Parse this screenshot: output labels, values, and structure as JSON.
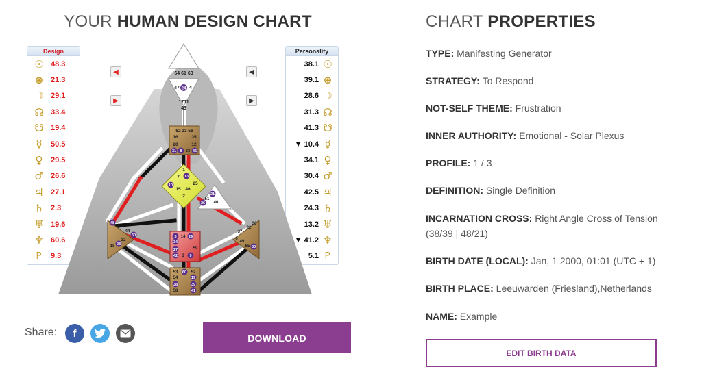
{
  "chart_title": {
    "prefix": "YOUR",
    "bold": "HUMAN DESIGN CHART"
  },
  "properties_title": {
    "prefix": "CHART",
    "bold": "PROPERTIES"
  },
  "design_column": {
    "header": "Design",
    "rows": [
      {
        "icon": "sun-icon",
        "value": "48.3"
      },
      {
        "icon": "earth-icon",
        "value": "21.3"
      },
      {
        "icon": "moon-icon",
        "value": "29.1"
      },
      {
        "icon": "north-node-icon",
        "value": "33.4"
      },
      {
        "icon": "south-node-icon",
        "value": "19.4"
      },
      {
        "icon": "mercury-icon",
        "value": "50.5"
      },
      {
        "icon": "venus-icon",
        "value": "29.5"
      },
      {
        "icon": "mars-icon",
        "value": "26.6"
      },
      {
        "icon": "jupiter-icon",
        "value": "27.1"
      },
      {
        "icon": "saturn-icon",
        "value": "2.3"
      },
      {
        "icon": "uranus-icon",
        "value": "19.6"
      },
      {
        "icon": "neptune-icon",
        "value": "60.6"
      },
      {
        "icon": "pluto-icon",
        "value": "9.3"
      }
    ]
  },
  "personality_column": {
    "header": "Personality",
    "rows": [
      {
        "icon": "sun-icon",
        "value": "38.1"
      },
      {
        "icon": "earth-icon",
        "value": "39.1"
      },
      {
        "icon": "moon-icon",
        "value": "28.6"
      },
      {
        "icon": "north-node-icon",
        "value": "31.3"
      },
      {
        "icon": "south-node-icon",
        "value": "41.3"
      },
      {
        "icon": "mercury-icon",
        "value": "▼ 10.4"
      },
      {
        "icon": "venus-icon",
        "value": "34.1"
      },
      {
        "icon": "mars-icon",
        "value": "30.4"
      },
      {
        "icon": "jupiter-icon",
        "value": "42.5"
      },
      {
        "icon": "saturn-icon",
        "value": "24.3"
      },
      {
        "icon": "uranus-icon",
        "value": "13.2"
      },
      {
        "icon": "neptune-icon",
        "value": "▼ 41.2"
      },
      {
        "icon": "pluto-icon",
        "value": "5.1"
      }
    ]
  },
  "glyphs": {
    "sun-icon": "☉",
    "earth-icon": "⊕",
    "moon-icon": "☽",
    "north-node-icon": "☊",
    "south-node-icon": "☋",
    "mercury-icon": "☿",
    "venus-icon": "♀",
    "mars-icon": "♂",
    "jupiter-icon": "♃",
    "saturn-icon": "♄",
    "uranus-icon": "♅",
    "neptune-icon": "♆",
    "pluto-icon": "♇"
  },
  "gates": {
    "head": [
      "64",
      "61",
      "63"
    ],
    "ajna": [
      "47",
      "24",
      "4"
    ],
    "ajna_low": [
      "17",
      "11",
      "43"
    ],
    "throat": [
      "62",
      "23",
      "56",
      "16",
      "35",
      "20",
      "12",
      "31",
      "8",
      "33",
      "45"
    ],
    "g_center": [
      "1",
      "7",
      "13",
      "10",
      "15",
      "46",
      "2",
      "25"
    ],
    "heart": [
      "21",
      "51",
      "26",
      "40"
    ],
    "spleen": [
      "48",
      "57",
      "44",
      "50",
      "32",
      "28",
      "18"
    ],
    "sacral": [
      "5",
      "14",
      "29",
      "34",
      "27",
      "42",
      "3",
      "9",
      "59"
    ],
    "solar": [
      "36",
      "22",
      "37",
      "6",
      "49",
      "55",
      "30"
    ],
    "root": [
      "53",
      "60",
      "52",
      "54",
      "19",
      "38",
      "39",
      "58",
      "41"
    ]
  },
  "share": {
    "label": "Share:",
    "facebook": "f",
    "twitter": "t"
  },
  "download_label": "DOWNLOAD",
  "properties": [
    {
      "label": "TYPE:",
      "value": "Manifesting Generator"
    },
    {
      "label": "STRATEGY:",
      "value": "To Respond"
    },
    {
      "label": "NOT-SELF THEME:",
      "value": "Frustration"
    },
    {
      "label": "INNER AUTHORITY:",
      "value": "Emotional - Solar Plexus"
    },
    {
      "label": "PROFILE:",
      "value": "1 / 3"
    },
    {
      "label": "DEFINITION:",
      "value": "Single Definition"
    },
    {
      "label": "INCARNATION CROSS:",
      "value": "Right Angle Cross of Tension (38/39 | 48/21)"
    },
    {
      "label": "BIRTH DATE (LOCAL):",
      "value": "Jan, 1 2000, 01:01 (UTC + 1)"
    },
    {
      "label": "BIRTH PLACE:",
      "value": "Leeuwarden (Friesland),Netherlands"
    },
    {
      "label": "NAME:",
      "value": "Example"
    }
  ],
  "edit_label": "EDIT BIRTH DATA",
  "colors": {
    "accent": "#8b3d8f",
    "design_red": "#e01f1f",
    "center_gold": "#c59b27"
  }
}
